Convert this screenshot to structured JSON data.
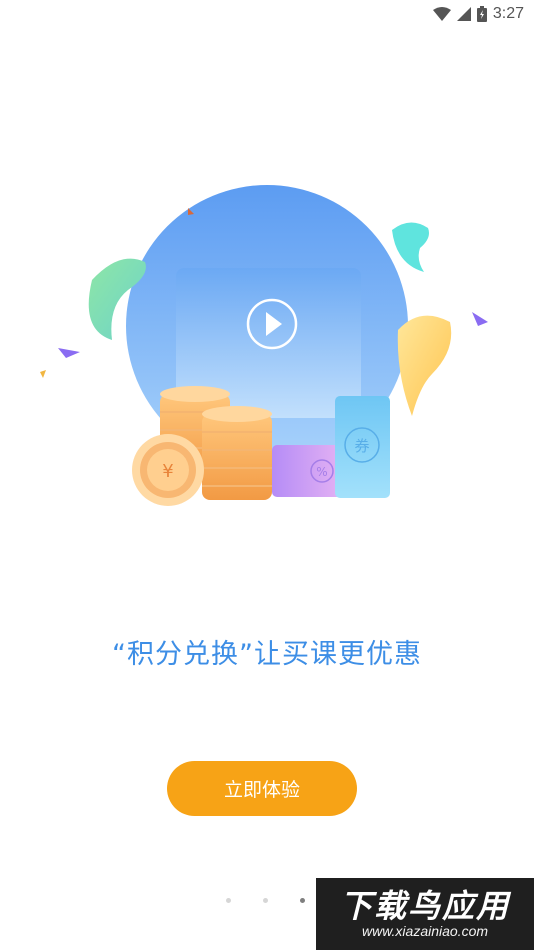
{
  "status_bar": {
    "time": "3:27",
    "icons": [
      "wifi-icon",
      "cellular-signal-icon",
      "battery-icon"
    ]
  },
  "illustration": {
    "coin_symbol": "¥",
    "coupon_symbol": "%",
    "ticket_symbol": "券"
  },
  "headline": "“积分兑换”让买课更优惠",
  "cta_button": {
    "label": "立即体验"
  },
  "pager": {
    "count": 4,
    "active_index": 2
  },
  "watermark": {
    "title": "下载鸟应用",
    "url": "www.xiazainiao.com"
  },
  "colors": {
    "accent_blue": "#3d8ee6",
    "button_orange": "#f7a316"
  }
}
